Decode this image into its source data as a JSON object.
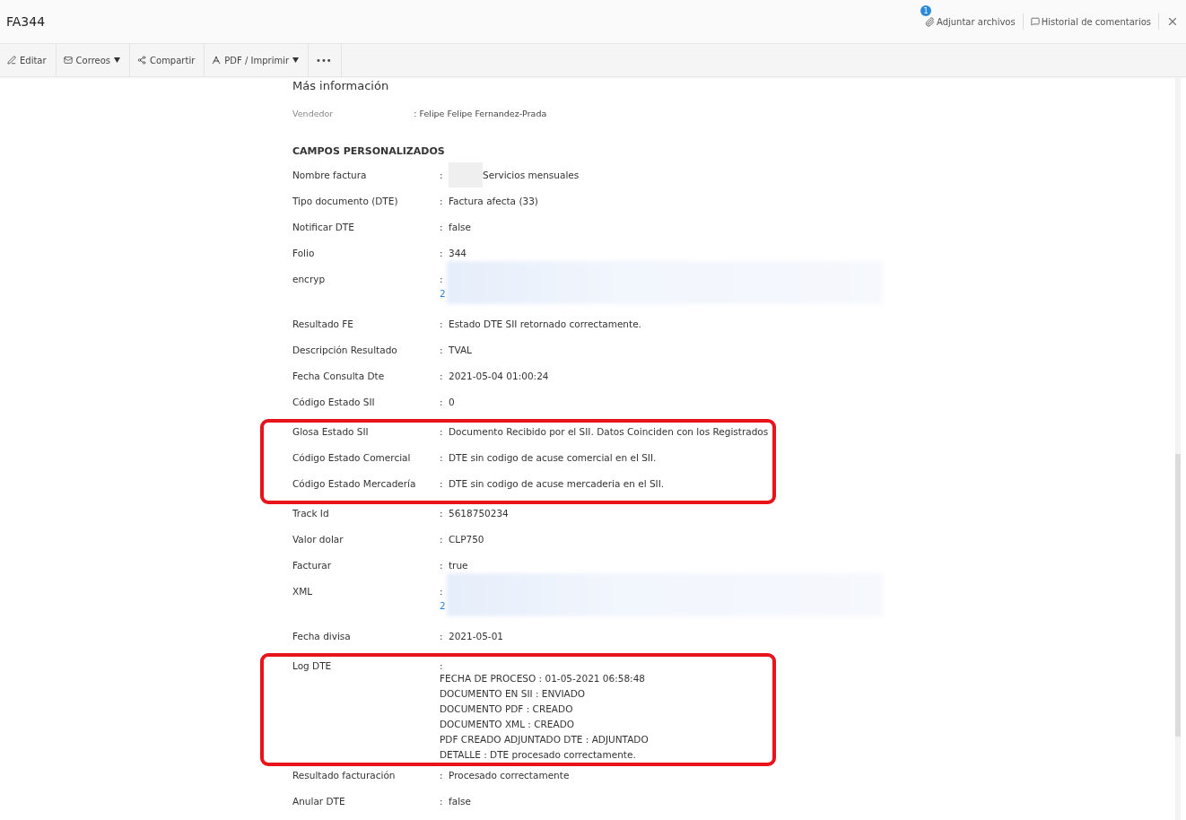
{
  "header": {
    "title": "FA344",
    "attach": {
      "label": "Adjuntar archivos",
      "badge": "1"
    },
    "comments": {
      "label": "Historial de comentarios"
    }
  },
  "toolbar": [
    {
      "label": "Editar",
      "dropdown": false
    },
    {
      "label": "Correos",
      "dropdown": true
    },
    {
      "label": "Compartir",
      "dropdown": false
    },
    {
      "label": "PDF / Imprimir",
      "dropdown": true
    },
    {
      "label": "•••",
      "dropdown": false
    }
  ],
  "more_info": {
    "heading": "Más información",
    "seller_label": "Vendedor",
    "seller_value": ": Felipe Felipe Fernandez-Prada"
  },
  "custom_fields": {
    "heading": "CAMPOS PERSONALIZADOS",
    "groups": [
      {
        "highlighted": false,
        "rows": [
          {
            "label": "Nombre factura",
            "colon": ":",
            "kind": "masked_text",
            "value": "Servicios mensuales"
          },
          {
            "label": "Tipo documento (DTE)",
            "colon": ":",
            "kind": "text",
            "value": "Factura afecta (33)"
          },
          {
            "label": "Notificar DTE",
            "colon": ":",
            "kind": "text",
            "value": "false"
          },
          {
            "label": "Folio",
            "colon": ":",
            "kind": "text",
            "value": "344"
          },
          {
            "label": "encryp",
            "colon": ":",
            "kind": "redacted",
            "value": "2"
          },
          {
            "label": "Resultado FE",
            "colon": ":",
            "kind": "text",
            "value": "Estado DTE SII retornado correctamente."
          },
          {
            "label": "Descripción Resultado",
            "colon": ":",
            "kind": "text",
            "value": "TVAL"
          },
          {
            "label": "Fecha Consulta Dte",
            "colon": ":",
            "kind": "text",
            "value": "2021-05-04 01:00:24"
          },
          {
            "label": "Código Estado SII",
            "colon": ":",
            "kind": "text",
            "value": "0"
          }
        ]
      },
      {
        "highlighted": true,
        "rows": [
          {
            "label": "Glosa Estado SII",
            "colon": ":",
            "kind": "text",
            "value": "Documento Recibido por el SII. Datos Coinciden con los Registrados"
          },
          {
            "label": "Código Estado Comercial",
            "colon": ":",
            "kind": "text",
            "value": "DTE sin codigo de acuse comercial en el SII."
          },
          {
            "label": "Código Estado Mercadería",
            "colon": ":",
            "kind": "text",
            "value": "DTE sin codigo de acuse mercaderia en el SII."
          }
        ]
      },
      {
        "highlighted": false,
        "rows": [
          {
            "label": "Track Id",
            "colon": ":",
            "kind": "text",
            "value": "5618750234"
          },
          {
            "label": "Valor dolar",
            "colon": ":",
            "kind": "text",
            "value": "CLP750"
          },
          {
            "label": "Facturar",
            "colon": ":",
            "kind": "text",
            "value": "true"
          },
          {
            "label": "XML",
            "colon": ":",
            "kind": "redacted",
            "value": "2"
          },
          {
            "label": "Fecha divisa",
            "colon": ":",
            "kind": "text",
            "value": "2021-05-01"
          }
        ]
      },
      {
        "highlighted": true,
        "rows": [
          {
            "label": "Log DTE",
            "colon": ":",
            "kind": "lines",
            "lines": [
              "FECHA DE PROCESO : 01-05-2021 06:58:48",
              "DOCUMENTO EN SII : ENVIADO",
              "DOCUMENTO PDF : CREADO",
              "DOCUMENTO XML : CREADO",
              "PDF CREADO ADJUNTADO DTE : ADJUNTADO",
              "DETALLE : DTE procesado correctamente."
            ]
          }
        ]
      },
      {
        "highlighted": false,
        "rows": [
          {
            "label": "Resultado facturación",
            "colon": ":",
            "kind": "text",
            "value": "Procesado correctamente"
          },
          {
            "label": "Anular DTE",
            "colon": ":",
            "kind": "text",
            "value": "false"
          }
        ]
      }
    ]
  }
}
